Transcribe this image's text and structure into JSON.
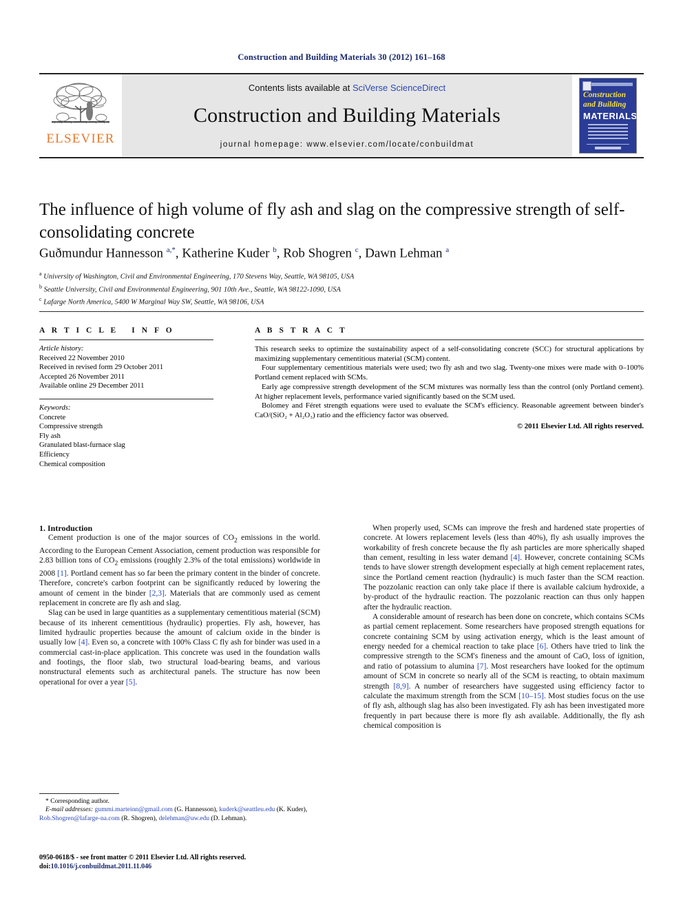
{
  "running_head": "Construction and Building Materials 30 (2012) 161–168",
  "masthead": {
    "contents_prefix": "Contents lists available at ",
    "sciencedirect": "SciVerse ScienceDirect",
    "journal_title": "Construction and Building Materials",
    "homepage": "journal homepage: www.elsevier.com/locate/conbuildmat",
    "publisher_name": "ELSEVIER",
    "cover": {
      "line1": "Construction",
      "line2": "and Building",
      "line3": "MATERIALS"
    },
    "colors": {
      "band_bg": "#e6e6e6",
      "link_blue": "#2b47b7",
      "elsevier_orange": "#e8792a",
      "cover_blue": "#2a3c96",
      "cover_yellow": "#f5e03c"
    }
  },
  "article": {
    "title": "The influence of high volume of fly ash and slag on the compressive strength of self-consolidating concrete",
    "authors_html": "Gu&#240;mundur Hannesson <sup>a,</sup><sup>*</sup>, Katherine Kuder <sup>b</sup>, Rob Shogren <sup>c</sup>, Dawn Lehman <sup>a</sup>",
    "affiliations": [
      "University of Washington, Civil and Environmental Engineering, 170 Stevens Way, Seattle, WA 98105, USA",
      "Seattle University, Civil and Environmental Engineering, 901 10th Ave., Seattle, WA 98122-1090, USA",
      "Lafarge North America, 5400 W Marginal Way SW, Seattle, WA 98106, USA"
    ],
    "affiliation_marks": [
      "a",
      "b",
      "c"
    ]
  },
  "info": {
    "heading": "ARTICLE INFO",
    "history_label": "Article history:",
    "history": [
      "Received 22 November 2010",
      "Received in revised form 29 October 2011",
      "Accepted 26 November 2011",
      "Available online 29 December 2011"
    ],
    "keywords_label": "Keywords:",
    "keywords": [
      "Concrete",
      "Compressive strength",
      "Fly ash",
      "Granulated blast-furnace slag",
      "Efficiency",
      "Chemical composition"
    ]
  },
  "abstract": {
    "heading": "ABSTRACT",
    "paragraphs": [
      "This research seeks to optimize the sustainability aspect of a self-consolidating concrete (SCC) for structural applications by maximizing supplementary cementitious material (SCM) content.",
      "Four supplementary cementitious materials were used; two fly ash and two slag. Twenty-one mixes were made with 0–100% Portland cement replaced with SCMs.",
      "Early age compressive strength development of the SCM mixtures was normally less than the control (only Portland cement). At higher replacement levels, performance varied significantly based on the SCM used.",
      "Bolomey and Féret strength equations were used to evaluate the SCM's efficiency. Reasonable agreement between binder's CaO/(SiO₂ + Al₂O₃) ratio and the efficiency factor was observed."
    ],
    "copyright": "© 2011 Elsevier Ltd. All rights reserved."
  },
  "body": {
    "section_heading": "1. Introduction",
    "left_paragraphs": [
      "Cement production is one of the major sources of CO2 emissions in the world. According to the European Cement Association, cement production was responsible for 2.83 billion tons of CO2 emissions (roughly 2.3% of the total emissions) worldwide in 2008 [1]. Portland cement has so far been the primary content in the binder of concrete. Therefore, concrete's carbon footprint can be significantly reduced by lowering the amount of cement in the binder [2,3]. Materials that are commonly used as cement replacement in concrete are fly ash and slag.",
      "Slag can be used in large quantities as a supplementary cementitious material (SCM) because of its inherent cementitious (hydraulic) properties. Fly ash, however, has limited hydraulic properties because the amount of calcium oxide in the binder is usually low [4]. Even so, a concrete with 100% Class C fly ash for binder was used in a commercial cast-in-place application. This concrete was used in the foundation walls and footings, the floor slab, two structural load-bearing beams, and various nonstructural elements such as architectural panels. The structure has now been operational for over a year [5]."
    ],
    "right_paragraphs": [
      "When properly used, SCMs can improve the fresh and hardened state properties of concrete. At lowers replacement levels (less than 40%), fly ash usually improves the workability of fresh concrete because the fly ash particles are more spherically shaped than cement, resulting in less water demand [4]. However, concrete containing SCMs tends to have slower strength development especially at high cement replacement rates, since the Portland cement reaction (hydraulic) is much faster than the SCM reaction. The pozzolanic reaction can only take place if there is available calcium hydroxide, a by-product of the hydraulic reaction. The pozzolanic reaction can thus only happen after the hydraulic reaction.",
      "A considerable amount of research has been done on concrete, which contains SCMs as partial cement replacement. Some researchers have proposed strength equations for concrete containing SCM by using activation energy, which is the least amount of energy needed for a chemical reaction to take place [6]. Others have tried to link the compressive strength to the SCM's fineness and the amount of CaO, loss of ignition, and ratio of potassium to alumina [7]. Most researchers have looked for the optimum amount of SCM in concrete so nearly all of the SCM is reacting, to obtain maximum strength [8,9]. A number of researchers have suggested using efficiency factor to calculate the maximum strength from the SCM [10–15]. Most studies focus on the use of fly ash, although slag has also been investigated. Fly ash has been investigated more frequently in part because there is more fly ash available. Additionally, the fly ash chemical composition is"
    ]
  },
  "footnote": {
    "corresponding": "* Corresponding author.",
    "email_label": "E-mail addresses:",
    "emails": [
      {
        "address": "gummi.marteinn@gmail.com",
        "person": "(G. Hannesson)"
      },
      {
        "address": "kuderk@seattleu.edu",
        "person": "(K. Kuder)"
      },
      {
        "address": "Rob.Shogren@lafarge-na.com",
        "person": "(R. Shogren)"
      },
      {
        "address": "delehman@uw.edu",
        "person": "(D. Lehman)"
      }
    ]
  },
  "colophon": {
    "issn_line": "0950-0618/$ - see front matter © 2011 Elsevier Ltd. All rights reserved.",
    "doi_label": "doi:",
    "doi": "10.1016/j.conbuildmat.2011.11.046"
  }
}
